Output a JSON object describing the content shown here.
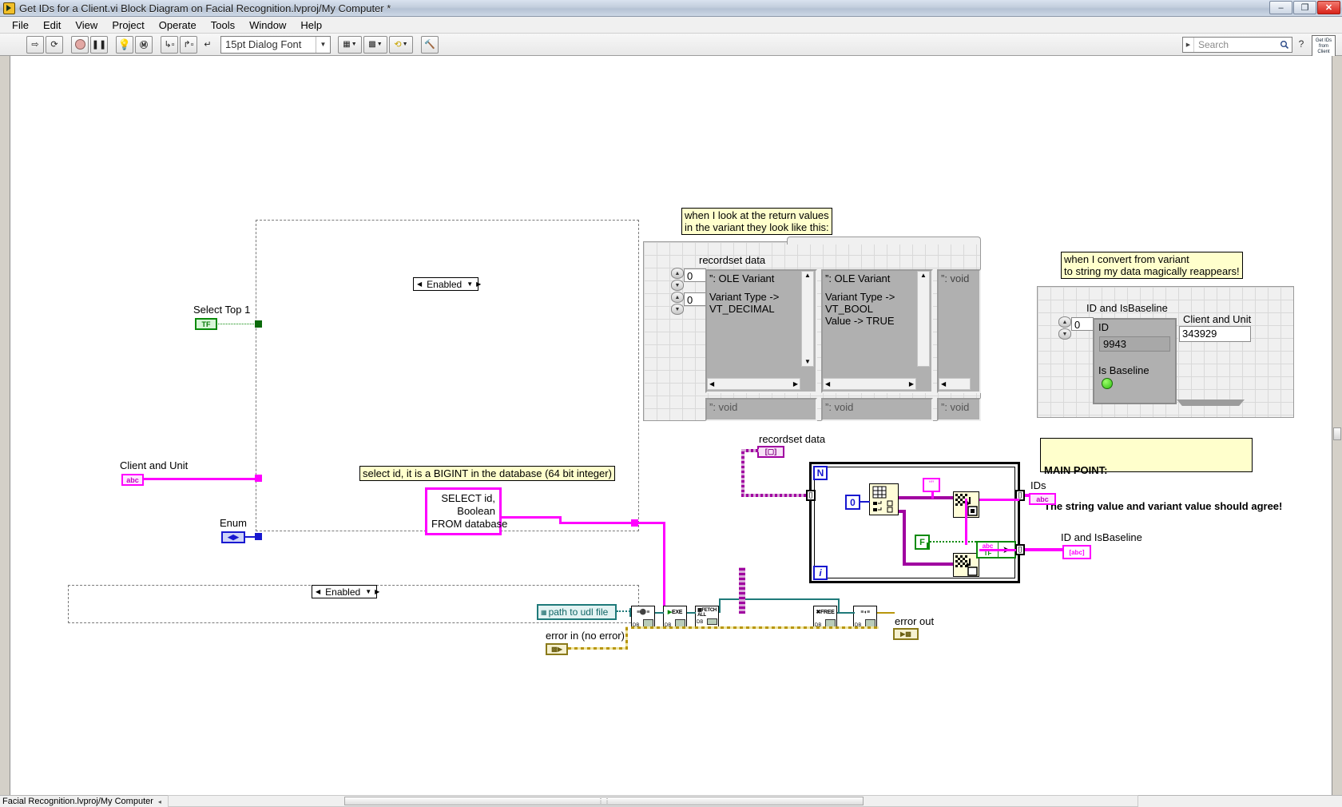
{
  "window": {
    "title": "Get IDs for a Client.vi Block Diagram on Facial Recognition.lvproj/My Computer *",
    "app_icon": "labview-vi-icon",
    "buttons": {
      "minimize": "–",
      "maximize": "❐",
      "close": "✕"
    }
  },
  "menubar": {
    "items": [
      "File",
      "Edit",
      "View",
      "Project",
      "Operate",
      "Tools",
      "Window",
      "Help"
    ]
  },
  "toolbar": {
    "run_label": "⇨",
    "run_continuous_label": "⟳",
    "abort_label": "●",
    "pause_label": "❚❚",
    "highlight_label": "◎",
    "retain_values_label": "Ⓟ",
    "step_into_label": "↳▫",
    "step_over_label": "↱▫",
    "step_out_label": "↵",
    "font": "15pt Dialog Font",
    "align_label": "░",
    "distribute_label": "▒",
    "resize_label": "▣",
    "reorder_label": "↻",
    "cleanup_label": "✨",
    "search": {
      "placeholder": "Search",
      "value": ""
    },
    "context_help": "?",
    "vi_icon_text": "Get IDs\nfrom\nClient"
  },
  "diagram": {
    "controls": {
      "select_top1": {
        "label": "Select Top 1",
        "terminal": "TF"
      },
      "client_and_unit": {
        "label": "Client and Unit",
        "terminal": "abc"
      },
      "enum": {
        "label": "Enum",
        "terminal": "◀▶"
      },
      "path_to_udl": {
        "label": "path to udl file"
      },
      "error_in": {
        "label": "error in (no error)"
      },
      "error_out": {
        "label": "error out"
      },
      "recordset_data_term": {
        "label": "recordset data"
      },
      "ids_indicator": {
        "label": "IDs",
        "terminal": "abc"
      },
      "id_and_isbaseline_indicator": {
        "label": "ID and IsBaseline"
      }
    },
    "structures": {
      "disabled_top": {
        "case": "Enabled"
      },
      "disabled_bottom": {
        "case": "Enabled"
      }
    },
    "constants": {
      "sql_query": "SELECT id,\nBoolean\nFROM database",
      "index_zero": "0",
      "false_const": "F",
      "empty_string": "“”"
    },
    "comments": {
      "sql_comment": "select id, it is a BIGINT in the database (64 bit integer)",
      "variant_note": "when I look at the return values\nin the variant they look like this:",
      "convert_note": "when I convert from variant\nto string my data magically reappears!",
      "main_point_title": "MAIN POINT:",
      "main_point_body": "The string value and variant value should agree!"
    },
    "db_vis": [
      {
        "name": "db-tools-open-connection",
        "top": "═●═",
        "label": "DB"
      },
      {
        "name": "db-tools-execute-query",
        "top": "▶ EXE",
        "label": "DB"
      },
      {
        "name": "db-tools-fetch-all",
        "top": "FETCH ALL",
        "label": "DB"
      },
      {
        "name": "db-tools-free-object",
        "top": "✕ FREE",
        "label": "DB"
      },
      {
        "name": "db-tools-close-connection",
        "top": "═◐═",
        "label": "DB"
      }
    ]
  },
  "panel_recordset": {
    "title": "recordset data",
    "index_top": "0",
    "index_bottom": "0",
    "cells": [
      {
        "header": "”: OLE Variant",
        "body": "Variant Type ->\nVT_DECIMAL"
      },
      {
        "header": "”: OLE Variant",
        "body": "Variant Type ->\nVT_BOOL\nValue -> TRUE"
      },
      {
        "header": "”: void",
        "body": ""
      }
    ],
    "row2": [
      "”: void",
      "”: void",
      "”: void"
    ]
  },
  "panel_id": {
    "title": "ID and IsBaseline",
    "index": "0",
    "id_label": "ID",
    "id_value": "9943",
    "isbaseline_label": "Is Baseline",
    "isbaseline_on": true,
    "client_unit_label": "Client and Unit",
    "client_unit_value": "343929"
  },
  "statusbar": {
    "text": "Facial Recognition.lvproj/My Computer",
    "arrow": "◂",
    "scroll_grip": "⋮⋮"
  },
  "colors": {
    "string_wire": "#ff00ff",
    "bool_wire": "#0a8a0a",
    "error_wire": "#b8960c",
    "path_wire": "#1f7a7a",
    "variant_wire": "#a000a0",
    "note_bg": "#ffffcc",
    "accent_blue": "#1818d0"
  }
}
